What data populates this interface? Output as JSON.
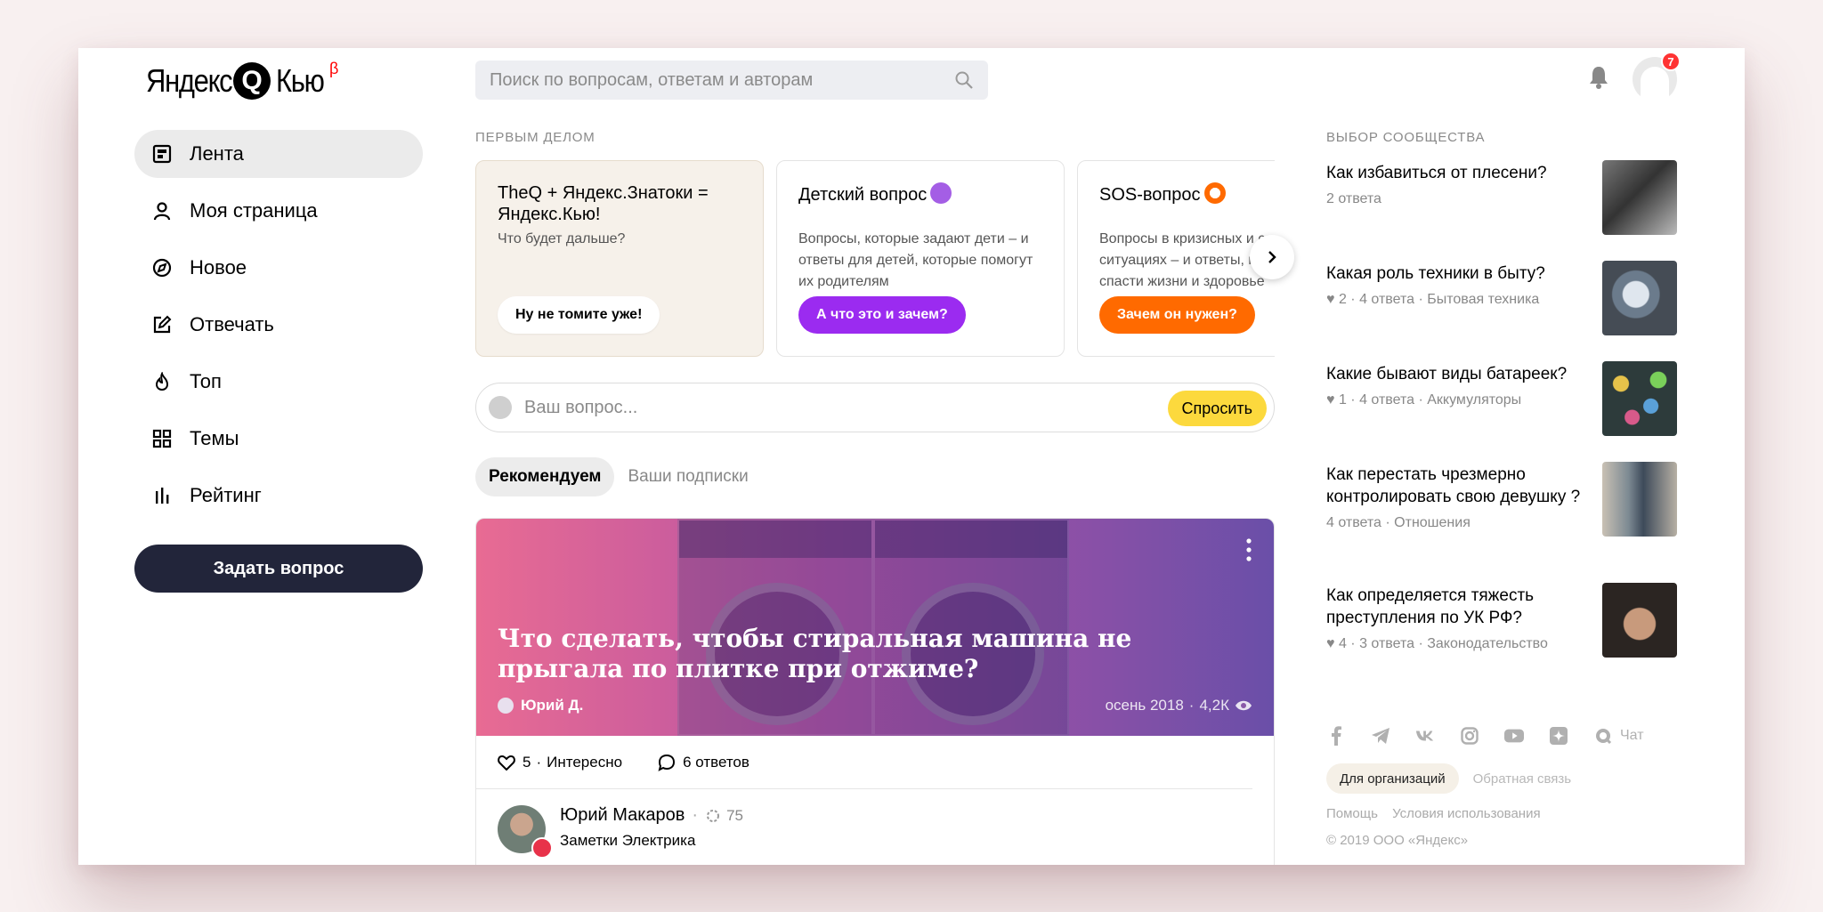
{
  "header": {
    "logo_word1": "Яндекс",
    "logo_mark": "Q",
    "logo_word2": "Кью",
    "logo_beta": "β",
    "search_placeholder": "Поиск по вопросам, ответам и авторам",
    "notification_count": "7"
  },
  "sidebar": {
    "items": [
      {
        "label": "Лента",
        "icon": "feed-icon"
      },
      {
        "label": "Моя страница",
        "icon": "user-icon"
      },
      {
        "label": "Новое",
        "icon": "compass-icon"
      },
      {
        "label": "Отвечать",
        "icon": "edit-icon"
      },
      {
        "label": "Топ",
        "icon": "flame-icon"
      },
      {
        "label": "Темы",
        "icon": "grid-icon"
      },
      {
        "label": "Рейтинг",
        "icon": "bars-icon"
      }
    ],
    "ask_button": "Задать вопрос"
  },
  "first": {
    "label": "Первым делом",
    "cards": [
      {
        "title": "TheQ + Яндекс.Знатоки = Яндекс.Кью!",
        "subtitle": "Что будет дальше?",
        "button": "Ну не томите уже!"
      },
      {
        "title": "Детский вопрос",
        "subtitle": "Вопросы, которые задают дети – и ответы для детей, которые помогут их родителям",
        "button": "А что это и зачем?",
        "emoji": "bear-emoji"
      },
      {
        "title": "SOS-вопрос",
        "subtitle": "Вопросы в кризисных и сложных ситуациях – и ответы, которые могут спасти жизни и здоровье",
        "button": "Зачем он нужен?",
        "emoji": "lifebuoy-emoji"
      }
    ]
  },
  "askbox": {
    "placeholder": "Ваш вопрос...",
    "button": "Спросить"
  },
  "tabs": [
    "Рекомендуем",
    "Ваши подписки"
  ],
  "post": {
    "title": "Что сделать, чтобы стиральная машина не прыгала по плитке при отжиме?",
    "author": "Юрий Д.",
    "date": "осень 2018",
    "views": "4,2К",
    "likes": "5",
    "likes_label": "Интересно",
    "answers": "6 ответов",
    "answer_author": "Юрий Макаров",
    "answer_score": "75",
    "answer_blog": "Заметки Электрика"
  },
  "community": {
    "label": "Выбор сообщества",
    "items": [
      {
        "title": "Как избавиться от плесени?",
        "meta": "2 ответа"
      },
      {
        "title": "Какая роль техники в быту?",
        "meta": "♥ 2 · 4 ответа · Бытовая техника"
      },
      {
        "title": "Какие бывают виды батареек?",
        "meta": "♥ 1 · 4 ответа · Аккумуляторы"
      },
      {
        "title": "Как перестать чрезмерно контролировать свою девушку ?",
        "meta": "4 ответа · Отношения"
      },
      {
        "title": "Как определяется тяжесть преступления по УК РФ?",
        "meta": "♥ 4 · 3 ответа · Законодательство"
      }
    ]
  },
  "footer": {
    "chat": "Чат",
    "org_button": "Для организаций",
    "feedback": "Обратная связь",
    "help": "Помощь",
    "terms": "Условия использования",
    "copyright": "© 2019 ООО «Яндекс»"
  },
  "colors": {
    "accent_dark": "#22253a",
    "ask_yellow": "#fcd93d",
    "purple": "#9b2bf0",
    "orange": "#ff6a00",
    "badge_red": "#ff3333"
  }
}
